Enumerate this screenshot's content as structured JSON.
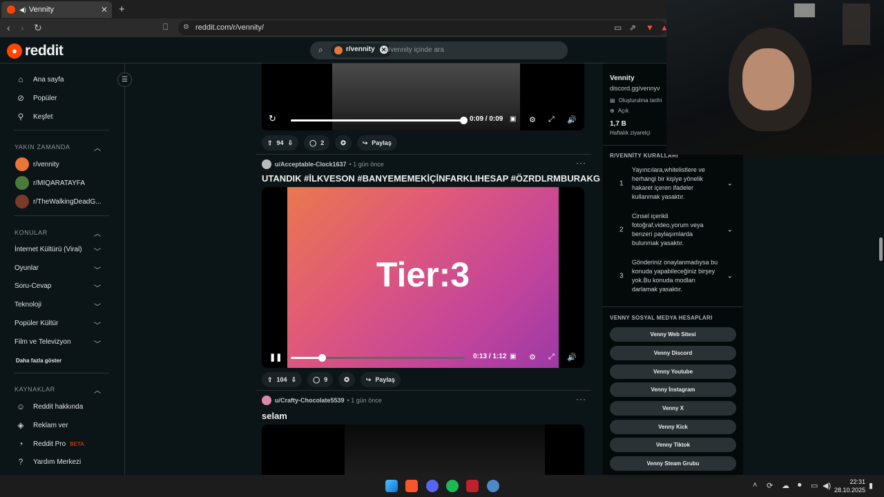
{
  "browser": {
    "tab_title": "Vennity",
    "url": "reddit.com/r/vennity/"
  },
  "header": {
    "logo_text": "reddit",
    "search_chip": "r/vennity",
    "search_placeholder": "r/vennity içinde ara"
  },
  "sidebar": {
    "nav": [
      {
        "label": "Ana sayfa",
        "icon": "home-icon"
      },
      {
        "label": "Popüler",
        "icon": "popular-icon"
      },
      {
        "label": "Keşfet",
        "icon": "explore-icon"
      }
    ],
    "recent_header": "YAKIN ZAMANDA",
    "recent": [
      {
        "label": "r/vennity",
        "color": "#e8763a"
      },
      {
        "label": "r/MIQARATAYFA",
        "color": "#4a7a3a"
      },
      {
        "label": "r/TheWalkingDeadG...",
        "color": "#7a3a2a"
      }
    ],
    "topics_header": "KONULAR",
    "topics": [
      "İnternet Kültürü (Viral)",
      "Oyunlar",
      "Soru-Cevap",
      "Teknoloji",
      "Popüler Kültür",
      "Film ve Televizyon"
    ],
    "more": "Daha fazla göster",
    "resources_header": "KAYNAKLAR",
    "resources": [
      {
        "label": "Reddit hakkında",
        "icon": "reddit-icon"
      },
      {
        "label": "Reklam ver",
        "icon": "megaphone-icon"
      },
      {
        "label": "Reddit Pro",
        "icon": "pro-icon",
        "badge": "BETA"
      },
      {
        "label": "Yardım Merkezi",
        "icon": "help-icon"
      }
    ]
  },
  "posts": [
    {
      "video_time": "0:09 / 0:09",
      "progress": 1.0,
      "votes": "94",
      "comments": "2",
      "share": "Paylaş"
    },
    {
      "author": "u/Acceptable-Clock1637",
      "time": "1 gün önce",
      "title": "UTANDIK #İLKVESON #BANYEMEMEKİÇİNFARKLIHESAP #ÖZRDLRMBURAKG",
      "video_text": "Tier:3",
      "video_time": "0:13 / 1:12",
      "progress": 0.18,
      "votes": "104",
      "comments": "9",
      "share": "Paylaş"
    },
    {
      "author": "u/Crafty-Chocolate5539",
      "time": "1 gün önce",
      "title": "selam"
    }
  ],
  "community": {
    "name": "Vennity",
    "link": "discord.gg/vennyv",
    "created_label": "Oluşturulma tarihi",
    "visibility": "Açık",
    "weekly_count": "1,7 B",
    "weekly_label": "Haftalık ziyaretçi",
    "rules_header": "R/VENNİTY KURALLARI",
    "rules": [
      {
        "n": "1",
        "text": "Yayıncılara,whitelistlere ve herhangi bir kişiye yönelik hakaret içeren ifadeler kullanmak yasaktır."
      },
      {
        "n": "2",
        "text": "Cinsel içerikli fotoğraf,video,yorum veya benzeri paylaşımlarda bulunmak yasaktır."
      },
      {
        "n": "3",
        "text": "Gönderiniz onaylanmadıysa bu konuda yapabileceğiniz birşey yok.Bu konuda modları darlamak yasaktır."
      }
    ],
    "social_header": "VENNY SOSYAL MEDYA HESAPLARI",
    "social": [
      "Venny Web Sitesi",
      "Venny Discord",
      "Venny Youtube",
      "Venny İnstagram",
      "Venny X",
      "Venny Kick",
      "Venny Tiktok",
      "Venny Steam Grubu"
    ]
  },
  "taskbar": {
    "time": "22:31",
    "date": "28.10.2025"
  }
}
